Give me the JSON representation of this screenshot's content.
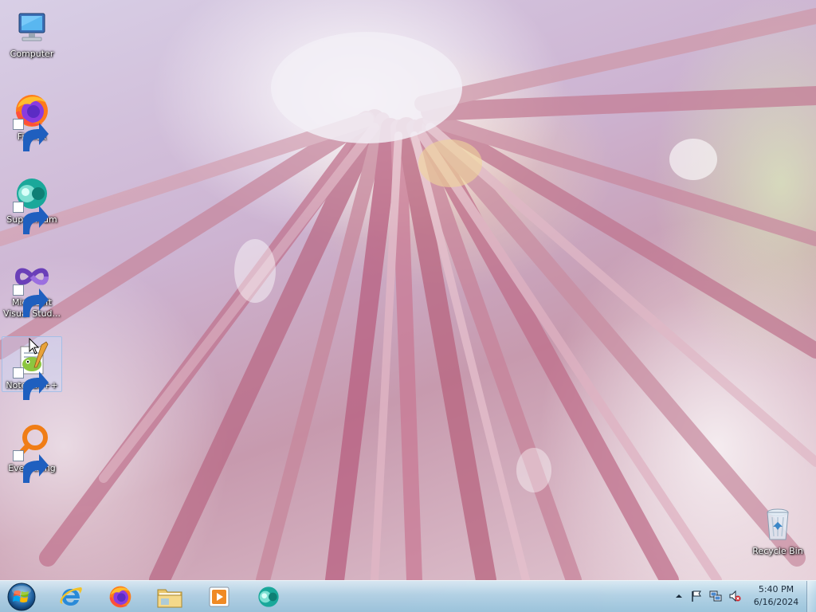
{
  "desktop": {
    "icons": [
      {
        "label": "Computer",
        "icon": "computer-icon"
      },
      {
        "label": "Firefox",
        "icon": "firefox-icon"
      },
      {
        "label": "Supermium",
        "icon": "supermium-icon"
      },
      {
        "label": "Microsoft Visual Stud...",
        "icon": "visual-studio-icon"
      },
      {
        "label": "Notepad++",
        "icon": "notepadpp-icon"
      },
      {
        "label": "Everything",
        "icon": "everything-icon"
      },
      {
        "label": "Recycle Bin",
        "icon": "recycle-bin-icon"
      }
    ],
    "selected_icon": "Notepad++"
  },
  "taskbar": {
    "start_icon": "windows-logo-icon",
    "pinned": [
      {
        "name": "Internet Explorer",
        "icon": "internet-explorer-icon"
      },
      {
        "name": "Firefox",
        "icon": "firefox-icon"
      },
      {
        "name": "Windows Explorer",
        "icon": "folder-icon"
      },
      {
        "name": "Windows Media Player",
        "icon": "media-player-icon"
      },
      {
        "name": "Supermium",
        "icon": "supermium-icon"
      }
    ],
    "tray": {
      "icons": [
        "show-hidden-icons-chevron",
        "action-center-flag-icon",
        "network-icon",
        "volume-muted-icon"
      ],
      "time": "5:40 PM",
      "date": "6/16/2024"
    }
  },
  "colors": {
    "taskbar_top": "#d7ebf5",
    "taskbar_bottom": "#96c3dc",
    "label_text": "#ffffff"
  }
}
